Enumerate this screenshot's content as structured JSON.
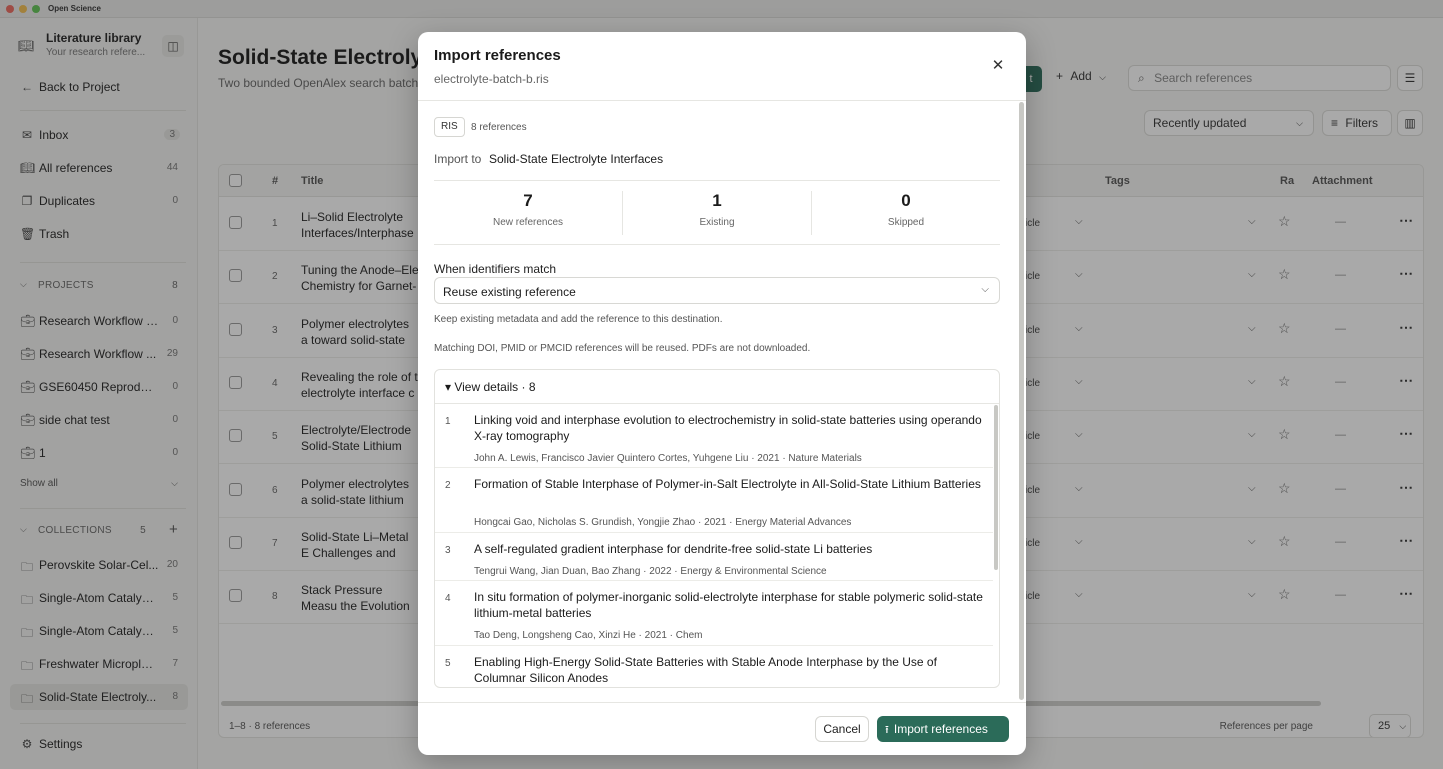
{
  "window": {
    "app_title": "Open Science"
  },
  "sidebar": {
    "library_title": "Literature library",
    "library_subtitle": "Your research refere...",
    "back_label": "Back to Project",
    "nav": [
      {
        "label": "Inbox",
        "count": "3",
        "icon": "inbox-icon"
      },
      {
        "label": "All references",
        "count": "44",
        "icon": "book-icon"
      },
      {
        "label": "Duplicates",
        "count": "0",
        "icon": "duplicate-icon"
      },
      {
        "label": "Trash",
        "count": "",
        "icon": "trash-icon"
      }
    ],
    "projects_header": "PROJECTS",
    "projects_count": "8",
    "projects": [
      {
        "label": "Research Workflow E...",
        "count": "0"
      },
      {
        "label": "Research Workflow ...",
        "count": "29"
      },
      {
        "label": "GSE60450 Reproduci...",
        "count": "0"
      },
      {
        "label": "side chat test",
        "count": "0"
      },
      {
        "label": "1",
        "count": "0"
      }
    ],
    "show_all": "Show all",
    "collections_header": "COLLECTIONS",
    "collections_count": "5",
    "collections": [
      {
        "label": "Perovskite Solar-Cel...",
        "count": "20"
      },
      {
        "label": "Single-Atom Catalysi...",
        "count": "5"
      },
      {
        "label": "Single-Atom Catalysi...",
        "count": "5"
      },
      {
        "label": "Freshwater Microplas...",
        "count": "7"
      },
      {
        "label": "Solid-State Electroly...",
        "count": "8"
      }
    ],
    "settings_label": "Settings"
  },
  "main": {
    "title": "Solid-State Electrolyte I",
    "subtitle": "Two bounded OpenAlex search batch",
    "add_label": "Add",
    "search_placeholder": "Search references",
    "sort_label": "Recently updated",
    "filters_label": "Filters",
    "columns": {
      "num": "#",
      "title": "Title",
      "tags": "Tags",
      "rating": "Ra",
      "attachment": "Attachment"
    },
    "rows": [
      {
        "num": "1",
        "title": "Li–Solid Electrolyte Interfaces/Interphase",
        "type": "icle"
      },
      {
        "num": "2",
        "title": "Tuning the Anode–Ele Chemistry for Garnet-",
        "type": "icle"
      },
      {
        "num": "3",
        "title": "Polymer electrolytes a toward solid-state bat",
        "type": "icle"
      },
      {
        "num": "4",
        "title": "Revealing the role of t electrolyte interface c",
        "type": "icle"
      },
      {
        "num": "5",
        "title": "Electrolyte/Electrode Solid-State Lithium Ba",
        "type": "icle"
      },
      {
        "num": "6",
        "title": "Polymer electrolytes a solid-state lithium me",
        "type": "icle"
      },
      {
        "num": "7",
        "title": "Solid-State Li–Metal E Challenges and Horiz",
        "type": "icle"
      },
      {
        "num": "8",
        "title": "Stack Pressure Measu the Evolution of the Li",
        "type": "icle"
      }
    ],
    "dash": "—",
    "footer_range": "1–8 · 8 references",
    "per_page_label": "References per page",
    "per_page_value": "25"
  },
  "modal": {
    "title": "Import references",
    "file_name": "electrolyte-batch-b.ris",
    "format_badge": "RIS",
    "format_count": "8 references",
    "import_to_label": "Import to",
    "import_to_value": "Solid-State Electrolyte Interfaces",
    "stats": [
      {
        "value": "7",
        "label": "New references"
      },
      {
        "value": "1",
        "label": "Existing"
      },
      {
        "value": "0",
        "label": "Skipped"
      }
    ],
    "match_label": "When identifiers match",
    "match_value": "Reuse existing reference",
    "hint_1": "Keep existing metadata and add the reference to this destination.",
    "hint_2": "Matching DOI, PMID or PMCID references will be reused. PDFs are not downloaded.",
    "details_label": "▾ View details · 8",
    "refs": [
      {
        "n": "1",
        "title": "Linking void and interphase evolution to electrochemistry in solid-state batteries using operando X-ray tomography",
        "meta": "John A. Lewis, Francisco Javier Quintero Cortes, Yuhgene Liu · 2021 · Nature Materials"
      },
      {
        "n": "2",
        "title": "Formation of Stable Interphase of Polymer-in-Salt Electrolyte in All-Solid-State Lithium Batteries",
        "meta": "Hongcai Gao, Nicholas S. Grundish, Yongjie Zhao · 2021 · Energy Material Advances"
      },
      {
        "n": "3",
        "title": "A self-regulated gradient interphase for dendrite-free solid-state Li batteries",
        "meta": "Tengrui Wang, Jian Duan, Bao Zhang · 2022 · Energy & Environmental Science"
      },
      {
        "n": "4",
        "title": "In situ formation of polymer-inorganic solid-electrolyte interphase for stable polymeric solid-state lithium-metal batteries",
        "meta": "Tao Deng, Longsheng Cao, Xinzi He · 2021 · Chem"
      },
      {
        "n": "5",
        "title": "Enabling High-Energy Solid-State Batteries with Stable Anode Interphase by the Use of Columnar Silicon Anodes",
        "meta": ""
      }
    ],
    "cancel_label": "Cancel",
    "import_label": "Import references"
  }
}
